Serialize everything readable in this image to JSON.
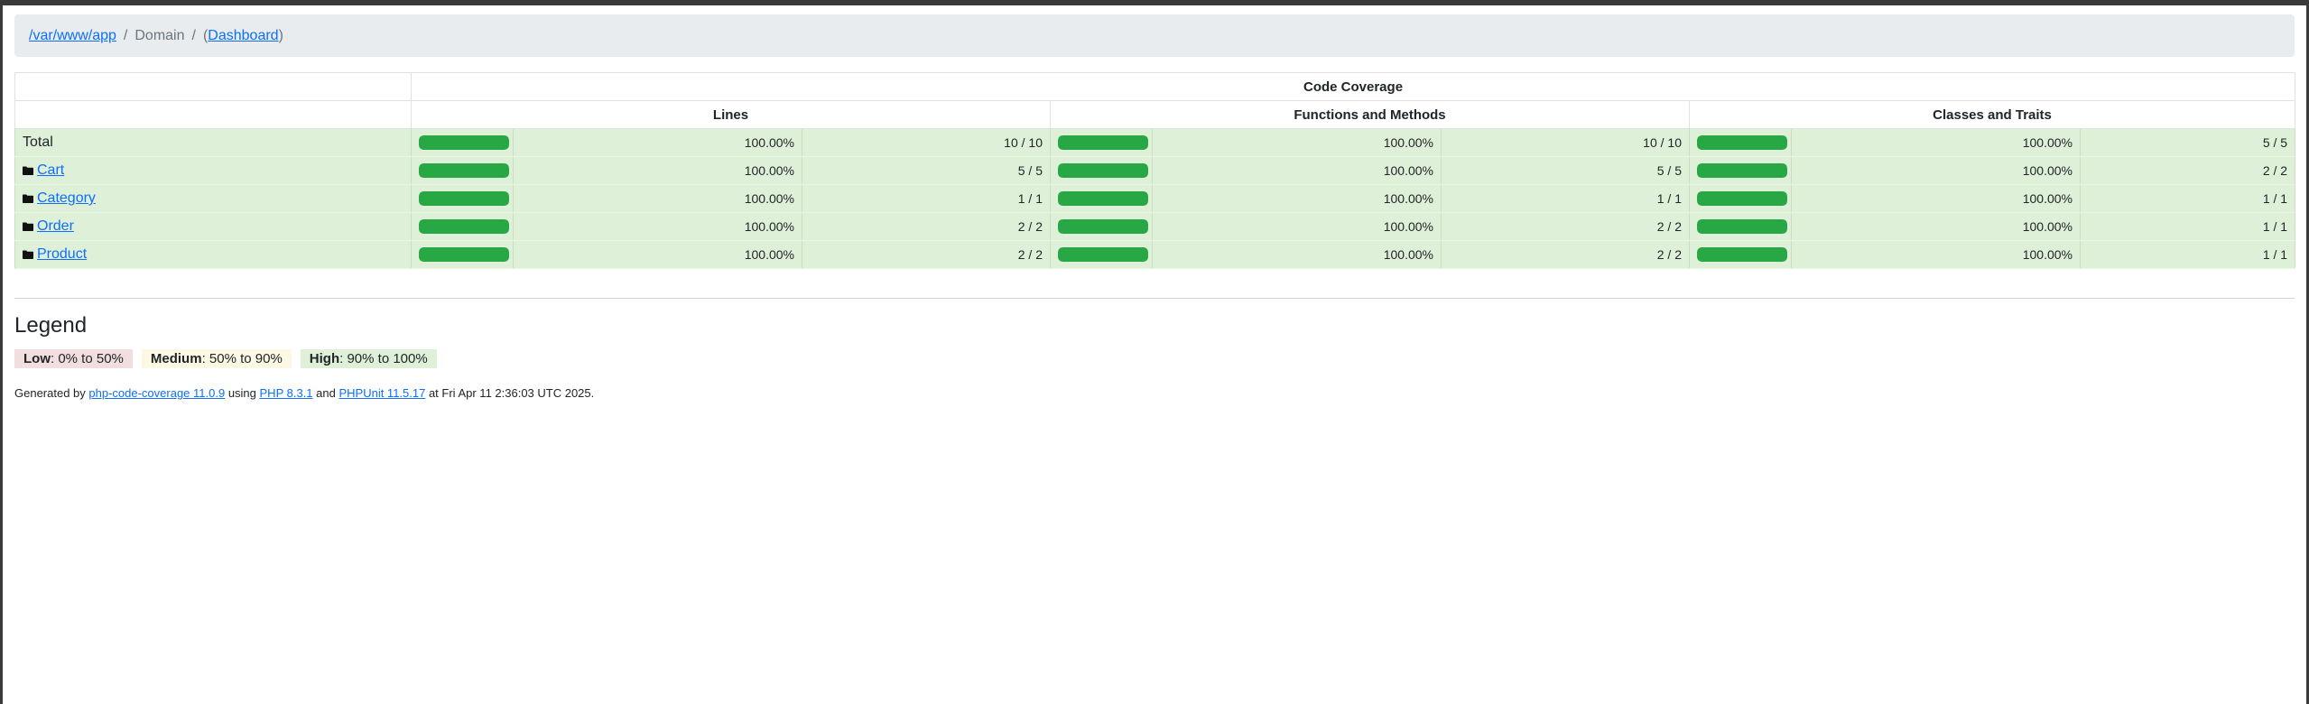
{
  "breadcrumb": {
    "root": "/var/www/app",
    "current": "Domain",
    "dashboard": "Dashboard",
    "sep1": "/",
    "sep2": "/",
    "open_paren": "(",
    "close_paren": ")"
  },
  "table": {
    "group_header": "Code Coverage",
    "columns": [
      "Lines",
      "Functions and Methods",
      "Classes and Traits"
    ],
    "rows": [
      {
        "name": "Total",
        "is_dir": false,
        "lines": {
          "pct": "100.00%",
          "ratio": "10 / 10",
          "value": 100
        },
        "functions": {
          "pct": "100.00%",
          "ratio": "10 / 10",
          "value": 100
        },
        "classes": {
          "pct": "100.00%",
          "ratio": "5 / 5",
          "value": 100
        }
      },
      {
        "name": "Cart",
        "is_dir": true,
        "lines": {
          "pct": "100.00%",
          "ratio": "5 / 5",
          "value": 100
        },
        "functions": {
          "pct": "100.00%",
          "ratio": "5 / 5",
          "value": 100
        },
        "classes": {
          "pct": "100.00%",
          "ratio": "2 / 2",
          "value": 100
        }
      },
      {
        "name": "Category",
        "is_dir": true,
        "lines": {
          "pct": "100.00%",
          "ratio": "1 / 1",
          "value": 100
        },
        "functions": {
          "pct": "100.00%",
          "ratio": "1 / 1",
          "value": 100
        },
        "classes": {
          "pct": "100.00%",
          "ratio": "1 / 1",
          "value": 100
        }
      },
      {
        "name": "Order",
        "is_dir": true,
        "lines": {
          "pct": "100.00%",
          "ratio": "2 / 2",
          "value": 100
        },
        "functions": {
          "pct": "100.00%",
          "ratio": "2 / 2",
          "value": 100
        },
        "classes": {
          "pct": "100.00%",
          "ratio": "1 / 1",
          "value": 100
        }
      },
      {
        "name": "Product",
        "is_dir": true,
        "lines": {
          "pct": "100.00%",
          "ratio": "2 / 2",
          "value": 100
        },
        "functions": {
          "pct": "100.00%",
          "ratio": "2 / 2",
          "value": 100
        },
        "classes": {
          "pct": "100.00%",
          "ratio": "1 / 1",
          "value": 100
        }
      }
    ]
  },
  "legend": {
    "title": "Legend",
    "low_label": "Low",
    "low_range": ": 0% to 50%",
    "medium_label": "Medium",
    "medium_range": ": 50% to 90%",
    "high_label": "High",
    "high_range": ": 90% to 100%"
  },
  "footer": {
    "prefix": "Generated by ",
    "tool": "php-code-coverage 11.0.9",
    "using": " using ",
    "php": "PHP 8.3.1",
    "and": " and ",
    "phpunit": "PHPUnit 11.5.17",
    "suffix": " at Fri Apr 11 2:36:03 UTC 2025."
  },
  "colors": {
    "high_bg": "#dff0d8",
    "bar_fill": "#28a745",
    "link": "#0d6efd"
  },
  "icons": {
    "directory": "folder-icon"
  }
}
